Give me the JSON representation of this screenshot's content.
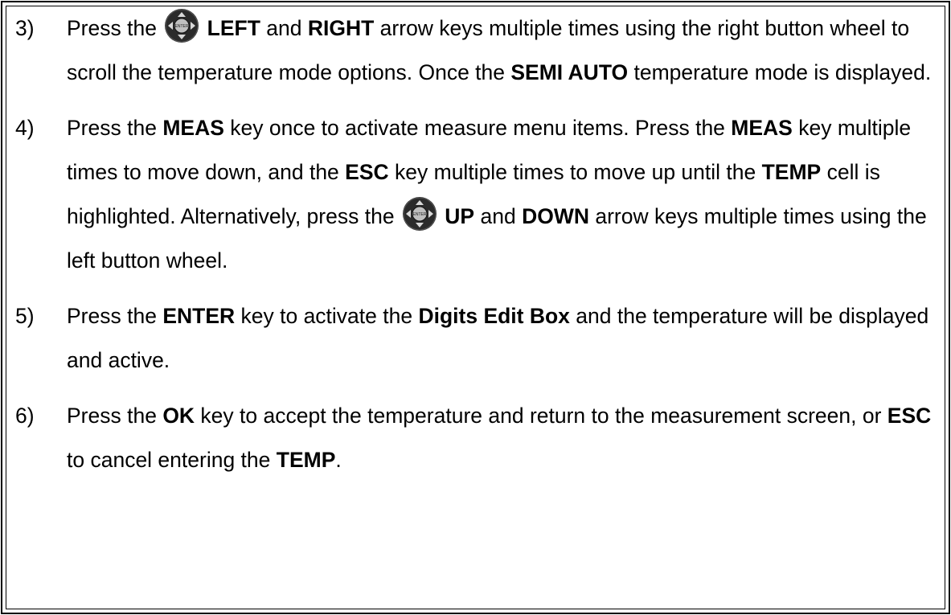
{
  "steps": [
    {
      "number": "3)",
      "segments": [
        {
          "text": "Press the ",
          "bold": false
        },
        {
          "icon": "dpad-enter-icon"
        },
        {
          "text": " LEFT",
          "bold": true
        },
        {
          "text": " and ",
          "bold": false
        },
        {
          "text": "RIGHT",
          "bold": true
        },
        {
          "text": " arrow keys multiple times using the right button wheel to scroll the temperature mode options.  Once the ",
          "bold": false
        },
        {
          "text": "SEMI AUTO",
          "bold": true
        },
        {
          "text": " temperature mode is displayed.",
          "bold": false
        }
      ]
    },
    {
      "number": "4)",
      "segments": [
        {
          "text": "Press the ",
          "bold": false
        },
        {
          "text": "MEAS",
          "bold": true
        },
        {
          "text": " key once to activate measure menu items.  Press the ",
          "bold": false
        },
        {
          "text": "MEAS",
          "bold": true
        },
        {
          "text": " key multiple times to move down, and the ",
          "bold": false
        },
        {
          "text": "ESC",
          "bold": true
        },
        {
          "text": " key multiple times to move up until the ",
          "bold": false
        },
        {
          "text": "TEMP",
          "bold": true
        },
        {
          "text": " cell is highlighted.  Alternatively, press the ",
          "bold": false
        },
        {
          "icon": "dpad-enter-icon"
        },
        {
          "text": " UP",
          "bold": true
        },
        {
          "text": " and ",
          "bold": false
        },
        {
          "text": "DOWN",
          "bold": true
        },
        {
          "text": " arrow keys multiple times using the left button wheel.",
          "bold": false
        }
      ]
    },
    {
      "number": "5)",
      "segments": [
        {
          "text": "Press the ",
          "bold": false
        },
        {
          "text": "ENTER",
          "bold": true
        },
        {
          "text": " key to activate the ",
          "bold": false
        },
        {
          "text": "Digits Edit Box",
          "bold": true
        },
        {
          "text": " and the temperature will be displayed and active.",
          "bold": false
        }
      ]
    },
    {
      "number": "6)",
      "segments": [
        {
          "text": "Press the ",
          "bold": false
        },
        {
          "text": "OK",
          "bold": true
        },
        {
          "text": " key to accept the temperature and return to the measurement screen, or ",
          "bold": false
        },
        {
          "text": "ESC",
          "bold": true
        },
        {
          "text": " to cancel entering the ",
          "bold": false
        },
        {
          "text": "TEMP",
          "bold": true
        },
        {
          "text": ".",
          "bold": false
        }
      ]
    }
  ],
  "icon_colors": {
    "ring": "#2b2b2b",
    "arrows": "#d9d9d9",
    "center": "#bfbfbf",
    "center_label": "ENTER"
  }
}
